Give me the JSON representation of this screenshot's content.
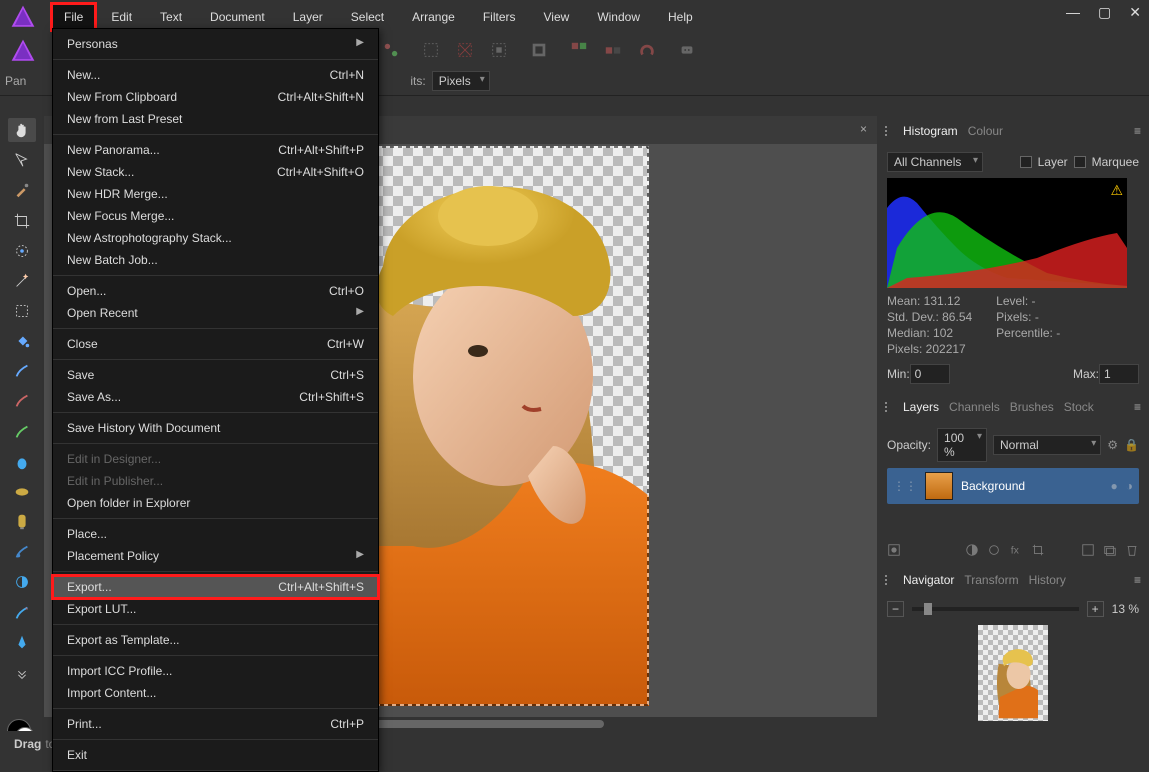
{
  "menubar": [
    "File",
    "Edit",
    "Text",
    "Document",
    "Layer",
    "Select",
    "Arrange",
    "Filters",
    "View",
    "Window",
    "Help"
  ],
  "context": {
    "panLabel": "Pan",
    "unitsLabel": "its:",
    "unitsValue": "Pixels"
  },
  "filemenu": {
    "groups": [
      [
        {
          "label": "Personas",
          "arrow": true
        }
      ],
      [
        {
          "label": "New...",
          "sc": "Ctrl+N"
        },
        {
          "label": "New From Clipboard",
          "sc": "Ctrl+Alt+Shift+N"
        },
        {
          "label": "New from Last Preset"
        }
      ],
      [
        {
          "label": "New Panorama...",
          "sc": "Ctrl+Alt+Shift+P"
        },
        {
          "label": "New Stack...",
          "sc": "Ctrl+Alt+Shift+O"
        },
        {
          "label": "New HDR Merge..."
        },
        {
          "label": "New Focus Merge..."
        },
        {
          "label": "New Astrophotography Stack..."
        },
        {
          "label": "New Batch Job..."
        }
      ],
      [
        {
          "label": "Open...",
          "sc": "Ctrl+O"
        },
        {
          "label": "Open Recent",
          "arrow": true
        }
      ],
      [
        {
          "label": "Close",
          "sc": "Ctrl+W"
        }
      ],
      [
        {
          "label": "Save",
          "sc": "Ctrl+S"
        },
        {
          "label": "Save As...",
          "sc": "Ctrl+Shift+S"
        }
      ],
      [
        {
          "label": "Save History With Document"
        }
      ],
      [
        {
          "label": "Edit in Designer...",
          "disabled": true
        },
        {
          "label": "Edit in Publisher...",
          "disabled": true
        },
        {
          "label": "Open folder in Explorer"
        }
      ],
      [
        {
          "label": "Place..."
        },
        {
          "label": "Placement Policy",
          "arrow": true
        }
      ],
      [
        {
          "label": "Export...",
          "sc": "Ctrl+Alt+Shift+S",
          "hl": true
        },
        {
          "label": "Export LUT..."
        }
      ],
      [
        {
          "label": "Export as Template..."
        }
      ],
      [
        {
          "label": "Import ICC Profile..."
        },
        {
          "label": "Import Content..."
        }
      ],
      [
        {
          "label": "Print...",
          "sc": "Ctrl+P"
        }
      ],
      [
        {
          "label": "Exit"
        }
      ]
    ]
  },
  "doctab": {
    "title": ""
  },
  "rightTop": {
    "tabs": [
      "Histogram",
      "Colour"
    ],
    "active": 0
  },
  "histogram": {
    "channelSel": "All Channels",
    "cbLayer": "Layer",
    "cbMarquee": "Marquee",
    "stats": [
      [
        "Mean: 131.12",
        "Std. Dev.: 86.54",
        "Median: 102",
        "Pixels: 202217"
      ],
      [
        "Level: -",
        "Pixels: -",
        "Percentile: -"
      ]
    ],
    "minLabel": "Min:",
    "minVal": "0",
    "maxLabel": "Max:",
    "maxVal": "1"
  },
  "layers": {
    "tabs": [
      "Layers",
      "Channels",
      "Brushes",
      "Stock"
    ],
    "active": 0,
    "opacityLabel": "Opacity:",
    "opacityVal": "100 %",
    "blend": "Normal",
    "rows": [
      {
        "name": "Background"
      }
    ]
  },
  "nav": {
    "tabs": [
      "Navigator",
      "Transform",
      "History"
    ],
    "active": 0,
    "zoom": "13 %"
  },
  "status": {
    "bold": "Drag",
    "rest": " to pan view."
  }
}
